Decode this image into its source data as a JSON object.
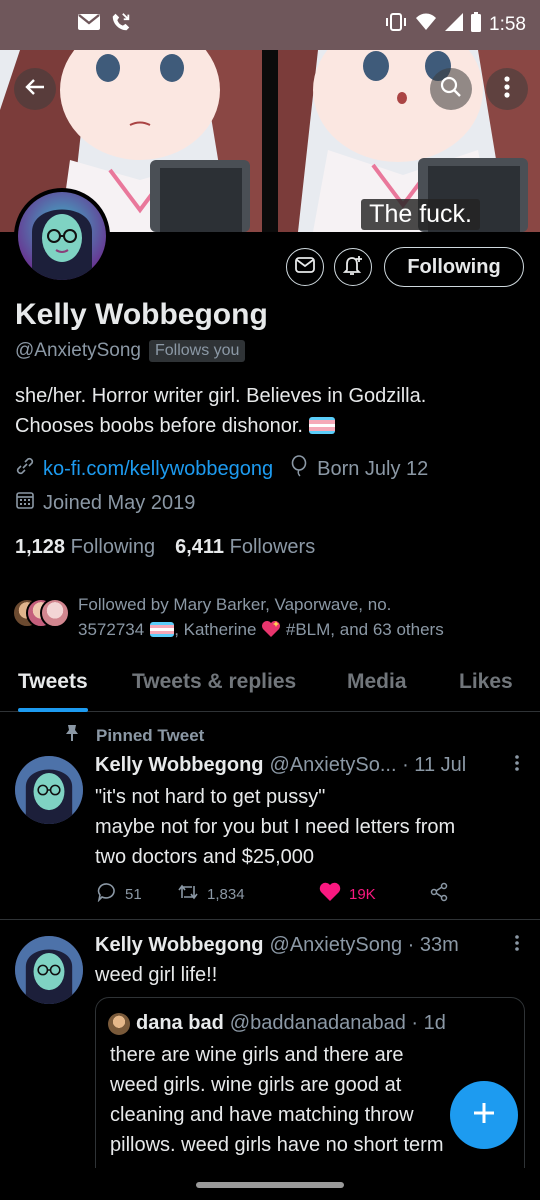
{
  "status_bar": {
    "time": "1:58",
    "left_icons": [
      "gmail-icon",
      "missed-call-icon"
    ],
    "right_icons": [
      "vibrate-icon",
      "wifi-icon",
      "signal-icon",
      "battery-icon"
    ]
  },
  "banner": {
    "caption": "The fuck."
  },
  "profile": {
    "name": "Kelly Wobbegong",
    "handle": "@AnxietySong",
    "follows_you": "Follows you",
    "bio_line1": "she/her. Horror writer girl. Believes in Godzilla.",
    "bio_line2": "Chooses boobs before dishonor.",
    "link": "ko-fi.com/kellywobbegong",
    "birthday": "Born July 12",
    "joined": "Joined May 2019",
    "following_count": "1,128",
    "following_label": "Following",
    "followers_count": "6,411",
    "followers_label": "Followers",
    "followed_by_prefix": "Followed by Mary Barker, Vaporwave, no.",
    "followed_by_number": "3572734",
    "followed_by_rest": ", Katherine",
    "followed_by_tail": "#BLM, and 63 others",
    "following_button": "Following"
  },
  "tabs": [
    {
      "label": "Tweets",
      "active": true
    },
    {
      "label": "Tweets & replies",
      "active": false
    },
    {
      "label": "Media",
      "active": false
    },
    {
      "label": "Likes",
      "active": false
    }
  ],
  "tweets": [
    {
      "pinned_label": "Pinned Tweet",
      "name": "Kelly Wobbegong",
      "handle_time": "@AnxietySo... · 11 Jul",
      "line1": "\"it's not hard to get pussy\"",
      "line2": "maybe not for you but I need letters from",
      "line3": "two doctors and $25,000",
      "replies": "51",
      "retweets": "1,834",
      "likes": "19K"
    },
    {
      "name": "Kelly Wobbegong",
      "handle_time": "@AnxietySong · 33m",
      "text": "weed girl life!!",
      "quote": {
        "name": "dana bad",
        "handle_time": "@baddanadanabad · 1d",
        "line1": "there are wine girls and there are",
        "line2": "weed girls. wine girls are good at",
        "line3": "cleaning and have matching throw",
        "line4": "pillows. weed girls have no short term"
      }
    }
  ],
  "colors": {
    "accent": "#1d9bf0",
    "like": "#f91880",
    "status_bar": "#6f575b",
    "text_secondary": "#8b98a5"
  }
}
